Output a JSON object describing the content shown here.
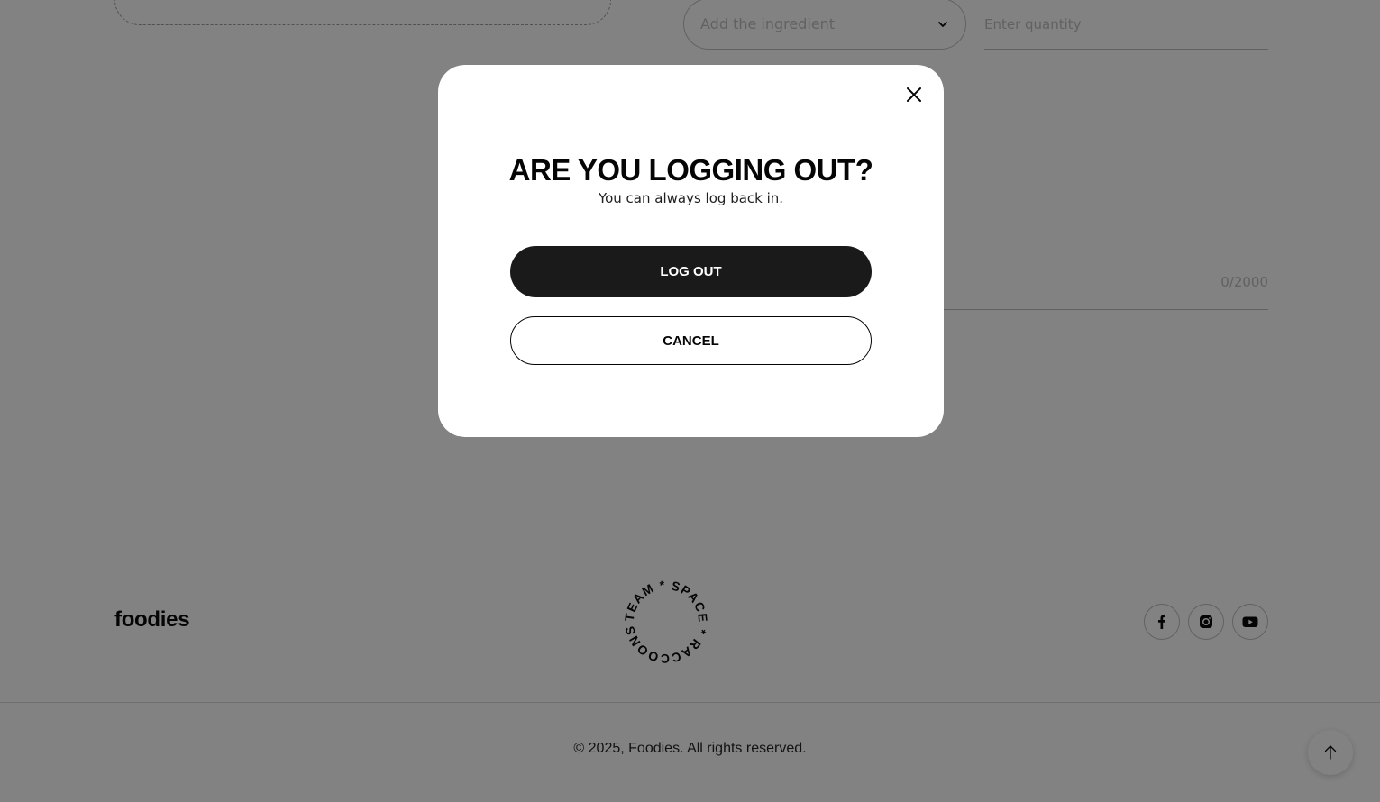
{
  "form": {
    "ingredient_placeholder": "Add the ingredient",
    "quantity_placeholder": "Enter quantity",
    "preparation_counter": "0/2000"
  },
  "footer": {
    "logo": "foodies",
    "badge_text": "TEAM * SPACE * RACCOONS * ",
    "socials": [
      "facebook-icon",
      "instagram-icon",
      "youtube-icon"
    ],
    "copyright": "© 2025, Foodies. All rights reserved."
  },
  "modal": {
    "title": "ARE YOU LOGGING OUT?",
    "subtitle": "You can always log back in.",
    "logout_label": "LOG OUT",
    "cancel_label": "CANCEL"
  },
  "colors": {
    "overlay": "#808080",
    "primary_button": "#1a1a1a",
    "text": "#050505"
  }
}
